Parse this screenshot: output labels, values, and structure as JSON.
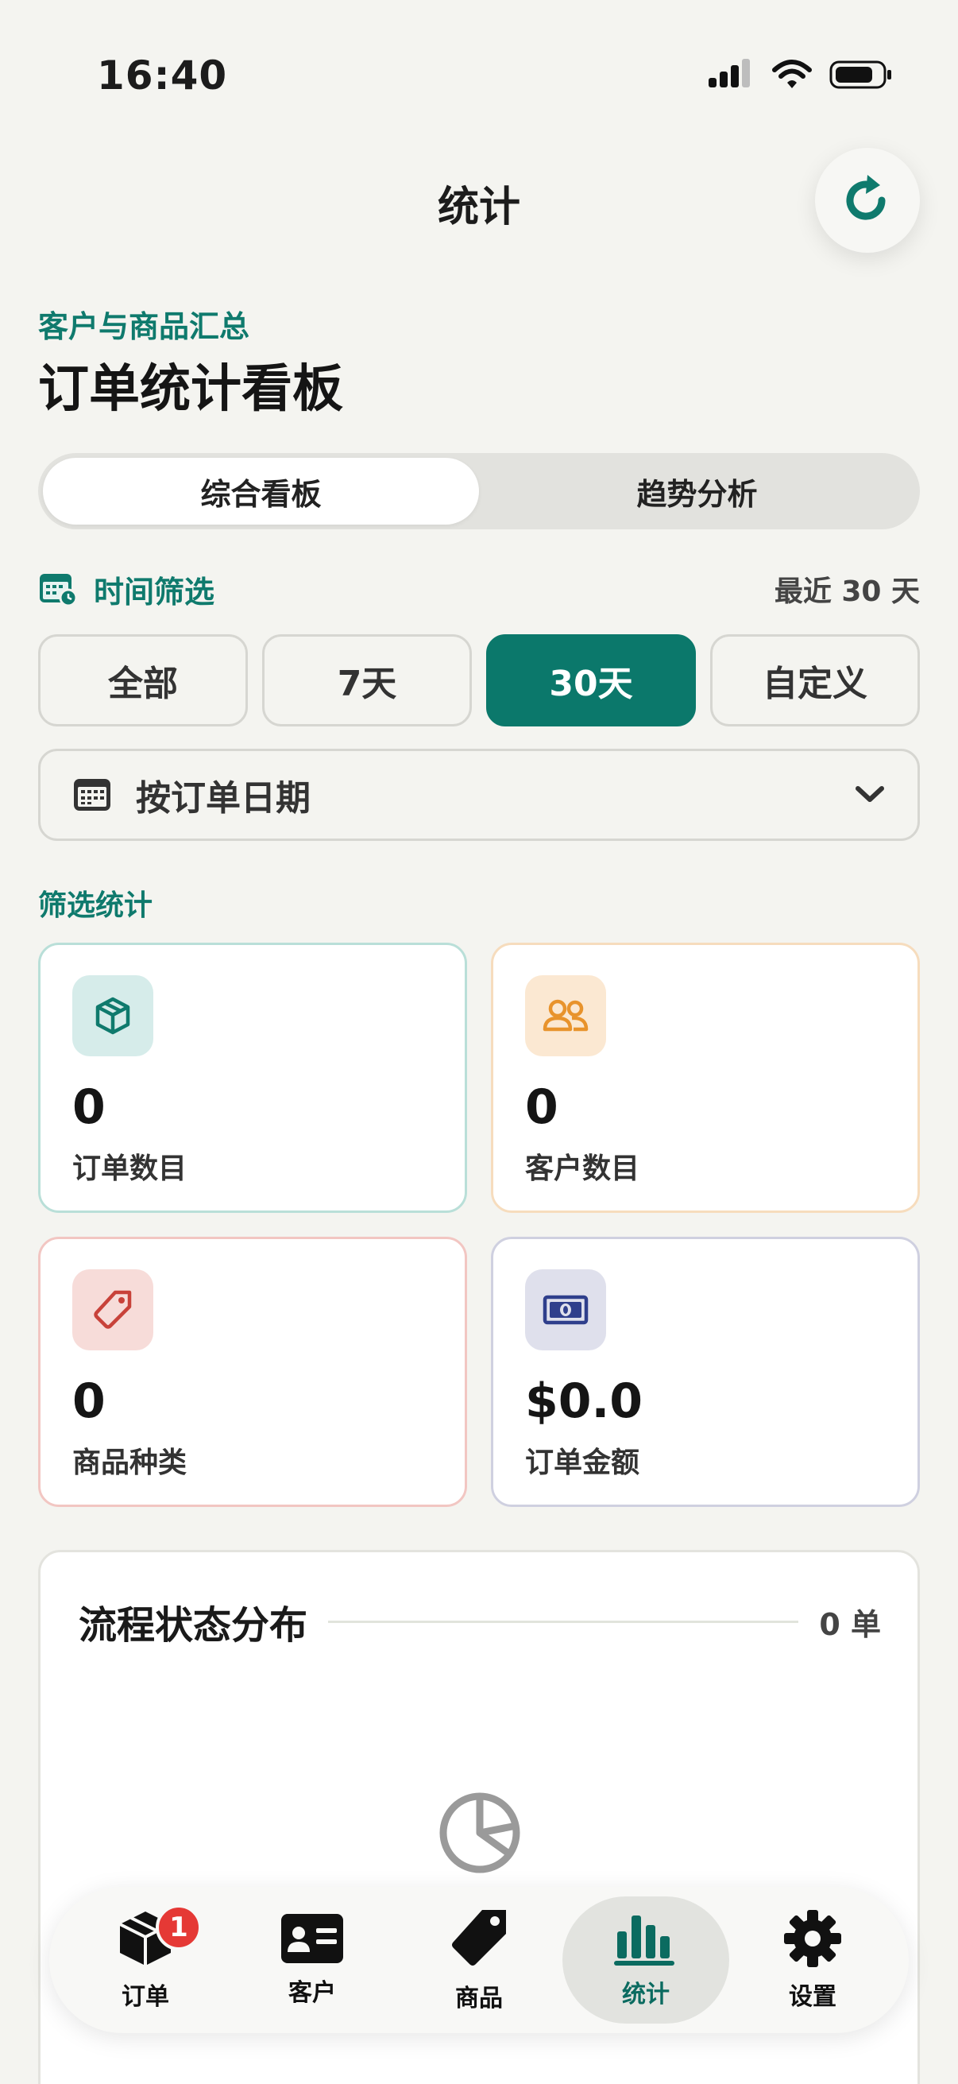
{
  "status_bar": {
    "time": "16:40"
  },
  "nav": {
    "title": "统计"
  },
  "header": {
    "subtitle": "客户与商品汇总",
    "title": "订单统计看板"
  },
  "segments": [
    {
      "label": "综合看板",
      "active": true
    },
    {
      "label": "趋势分析",
      "active": false
    }
  ],
  "filter": {
    "label": "时间筛选",
    "range_text": "最近 30 天",
    "chips": [
      {
        "label": "全部",
        "active": false
      },
      {
        "label": "7天",
        "active": false
      },
      {
        "label": "30天",
        "active": true
      },
      {
        "label": "自定义",
        "active": false
      }
    ],
    "date_mode": "按订单日期"
  },
  "stats": {
    "section_label": "筛选统计",
    "cards": [
      {
        "value": "0",
        "label": "订单数目",
        "icon": "box-icon",
        "color": "#0f7a6d"
      },
      {
        "value": "0",
        "label": "客户数目",
        "icon": "users-icon",
        "color": "#e8932c"
      },
      {
        "value": "0",
        "label": "商品种类",
        "icon": "tag-icon",
        "color": "#c8423a"
      },
      {
        "value": "$0.0",
        "label": "订单金额",
        "icon": "money-icon",
        "color": "#2f3f8c"
      }
    ]
  },
  "distribution": {
    "title": "流程状态分布",
    "count": "0 单"
  },
  "tabbar": {
    "items": [
      {
        "label": "订单",
        "icon": "package-icon",
        "badge": "1",
        "active": false
      },
      {
        "label": "客户",
        "icon": "contact-card-icon",
        "active": false
      },
      {
        "label": "商品",
        "icon": "tag-icon",
        "active": false
      },
      {
        "label": "统计",
        "icon": "bar-chart-icon",
        "active": true
      },
      {
        "label": "设置",
        "icon": "gear-icon",
        "active": false
      }
    ]
  },
  "colors": {
    "accent": "#0b786b",
    "background": "#f4f4f0"
  }
}
